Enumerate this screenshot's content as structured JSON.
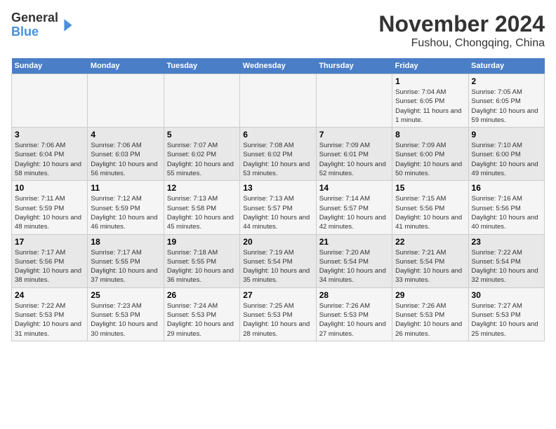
{
  "header": {
    "logo": {
      "line1": "General",
      "line2": "Blue"
    },
    "title": "November 2024",
    "subtitle": "Fushou, Chongqing, China"
  },
  "days_of_week": [
    "Sunday",
    "Monday",
    "Tuesday",
    "Wednesday",
    "Thursday",
    "Friday",
    "Saturday"
  ],
  "weeks": [
    [
      {
        "day": "",
        "info": ""
      },
      {
        "day": "",
        "info": ""
      },
      {
        "day": "",
        "info": ""
      },
      {
        "day": "",
        "info": ""
      },
      {
        "day": "",
        "info": ""
      },
      {
        "day": "1",
        "info": "Sunrise: 7:04 AM\nSunset: 6:05 PM\nDaylight: 11 hours and 1 minute."
      },
      {
        "day": "2",
        "info": "Sunrise: 7:05 AM\nSunset: 6:05 PM\nDaylight: 10 hours and 59 minutes."
      }
    ],
    [
      {
        "day": "3",
        "info": "Sunrise: 7:06 AM\nSunset: 6:04 PM\nDaylight: 10 hours and 58 minutes."
      },
      {
        "day": "4",
        "info": "Sunrise: 7:06 AM\nSunset: 6:03 PM\nDaylight: 10 hours and 56 minutes."
      },
      {
        "day": "5",
        "info": "Sunrise: 7:07 AM\nSunset: 6:02 PM\nDaylight: 10 hours and 55 minutes."
      },
      {
        "day": "6",
        "info": "Sunrise: 7:08 AM\nSunset: 6:02 PM\nDaylight: 10 hours and 53 minutes."
      },
      {
        "day": "7",
        "info": "Sunrise: 7:09 AM\nSunset: 6:01 PM\nDaylight: 10 hours and 52 minutes."
      },
      {
        "day": "8",
        "info": "Sunrise: 7:09 AM\nSunset: 6:00 PM\nDaylight: 10 hours and 50 minutes."
      },
      {
        "day": "9",
        "info": "Sunrise: 7:10 AM\nSunset: 6:00 PM\nDaylight: 10 hours and 49 minutes."
      }
    ],
    [
      {
        "day": "10",
        "info": "Sunrise: 7:11 AM\nSunset: 5:59 PM\nDaylight: 10 hours and 48 minutes."
      },
      {
        "day": "11",
        "info": "Sunrise: 7:12 AM\nSunset: 5:59 PM\nDaylight: 10 hours and 46 minutes."
      },
      {
        "day": "12",
        "info": "Sunrise: 7:13 AM\nSunset: 5:58 PM\nDaylight: 10 hours and 45 minutes."
      },
      {
        "day": "13",
        "info": "Sunrise: 7:13 AM\nSunset: 5:57 PM\nDaylight: 10 hours and 44 minutes."
      },
      {
        "day": "14",
        "info": "Sunrise: 7:14 AM\nSunset: 5:57 PM\nDaylight: 10 hours and 42 minutes."
      },
      {
        "day": "15",
        "info": "Sunrise: 7:15 AM\nSunset: 5:56 PM\nDaylight: 10 hours and 41 minutes."
      },
      {
        "day": "16",
        "info": "Sunrise: 7:16 AM\nSunset: 5:56 PM\nDaylight: 10 hours and 40 minutes."
      }
    ],
    [
      {
        "day": "17",
        "info": "Sunrise: 7:17 AM\nSunset: 5:56 PM\nDaylight: 10 hours and 38 minutes."
      },
      {
        "day": "18",
        "info": "Sunrise: 7:17 AM\nSunset: 5:55 PM\nDaylight: 10 hours and 37 minutes."
      },
      {
        "day": "19",
        "info": "Sunrise: 7:18 AM\nSunset: 5:55 PM\nDaylight: 10 hours and 36 minutes."
      },
      {
        "day": "20",
        "info": "Sunrise: 7:19 AM\nSunset: 5:54 PM\nDaylight: 10 hours and 35 minutes."
      },
      {
        "day": "21",
        "info": "Sunrise: 7:20 AM\nSunset: 5:54 PM\nDaylight: 10 hours and 34 minutes."
      },
      {
        "day": "22",
        "info": "Sunrise: 7:21 AM\nSunset: 5:54 PM\nDaylight: 10 hours and 33 minutes."
      },
      {
        "day": "23",
        "info": "Sunrise: 7:22 AM\nSunset: 5:54 PM\nDaylight: 10 hours and 32 minutes."
      }
    ],
    [
      {
        "day": "24",
        "info": "Sunrise: 7:22 AM\nSunset: 5:53 PM\nDaylight: 10 hours and 31 minutes."
      },
      {
        "day": "25",
        "info": "Sunrise: 7:23 AM\nSunset: 5:53 PM\nDaylight: 10 hours and 30 minutes."
      },
      {
        "day": "26",
        "info": "Sunrise: 7:24 AM\nSunset: 5:53 PM\nDaylight: 10 hours and 29 minutes."
      },
      {
        "day": "27",
        "info": "Sunrise: 7:25 AM\nSunset: 5:53 PM\nDaylight: 10 hours and 28 minutes."
      },
      {
        "day": "28",
        "info": "Sunrise: 7:26 AM\nSunset: 5:53 PM\nDaylight: 10 hours and 27 minutes."
      },
      {
        "day": "29",
        "info": "Sunrise: 7:26 AM\nSunset: 5:53 PM\nDaylight: 10 hours and 26 minutes."
      },
      {
        "day": "30",
        "info": "Sunrise: 7:27 AM\nSunset: 5:53 PM\nDaylight: 10 hours and 25 minutes."
      }
    ]
  ]
}
